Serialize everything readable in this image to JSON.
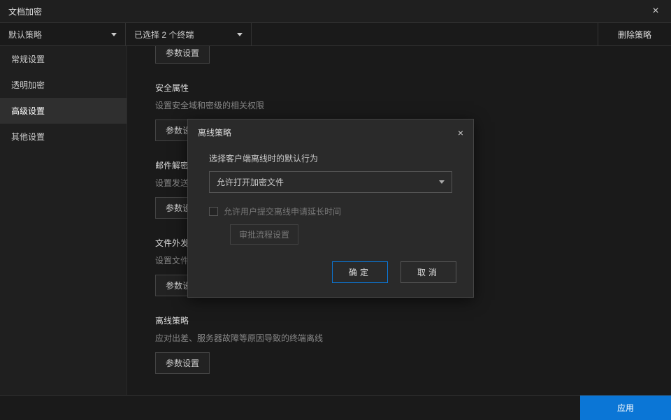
{
  "titlebar": {
    "title": "文档加密",
    "close": "×"
  },
  "toolbar": {
    "policy_select": "默认策略",
    "terminal_select": "已选择 2 个终端",
    "delete_btn": "删除策略"
  },
  "sidebar": {
    "items": [
      {
        "label": "常规设置"
      },
      {
        "label": "透明加密"
      },
      {
        "label": "高级设置"
      },
      {
        "label": "其他设置"
      }
    ]
  },
  "content": {
    "btn_param": "参数设置",
    "sections": [
      {
        "title": "安全属性",
        "desc": "设置安全域和密级的相关权限"
      },
      {
        "title": "邮件解密",
        "desc": "设置发送…"
      },
      {
        "title": "文件外发",
        "desc": "设置文件…"
      },
      {
        "title": "离线策略",
        "desc": "应对出差、服务器故障等原因导致的终端离线"
      }
    ],
    "partial_btn": "参数设"
  },
  "modal": {
    "title": "离线策略",
    "close": "×",
    "select_label": "选择客户端离线时的默认行为",
    "select_value": "允许打开加密文件",
    "checkbox_label": "允许用户提交离线申请延长时间",
    "sub_button": "审批流程设置",
    "ok": "确定",
    "cancel": "取消"
  },
  "footer": {
    "apply": "应用"
  }
}
